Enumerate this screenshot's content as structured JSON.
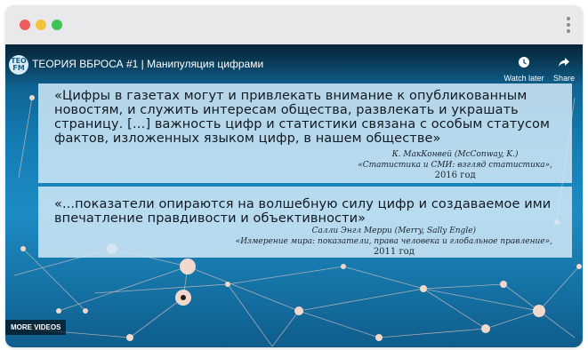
{
  "window": {
    "traffic_lights": [
      "close",
      "minimize",
      "maximize"
    ],
    "menu_icon": "kebab-menu-icon"
  },
  "video": {
    "channel_logo_text": "ТЕО FM",
    "title": "ТЕОРИЯ ВБРОСА #1 | Манипуляция цифрами",
    "watch_later_label": "Watch later",
    "share_label": "Share",
    "more_videos_label": "MORE VIDEOS"
  },
  "quotes": [
    {
      "text": "«Цифры в газетах могут и привлекать внимание к опубликованным новостям, и служить интересам общества, развлекать и украшать страницу. […] важность цифр и статистики связана с особым статусом фактов, изложенных языком цифр, в нашем обществе»",
      "author": "К. МакКонвей (McConway, K.)",
      "source": "«Статистика и СМИ: взгляд статистика»,",
      "year": "2016 год"
    },
    {
      "text": "«...показатели опираются на волшебную силу цифр и создаваемое ими впечатление правдивости и объективности»",
      "author": "Салли Энгл Мерри (Merry, Sally Engle)",
      "source": "«Измерение мира: показатели, права человека и глобальное правление»,",
      "year": "2011 год"
    }
  ],
  "colors": {
    "close": "#ed5b5b",
    "minimize": "#f3c43b",
    "maximize": "#3cc454",
    "video_bg": "#137ab0",
    "quote_box": "#d0e8f6"
  }
}
